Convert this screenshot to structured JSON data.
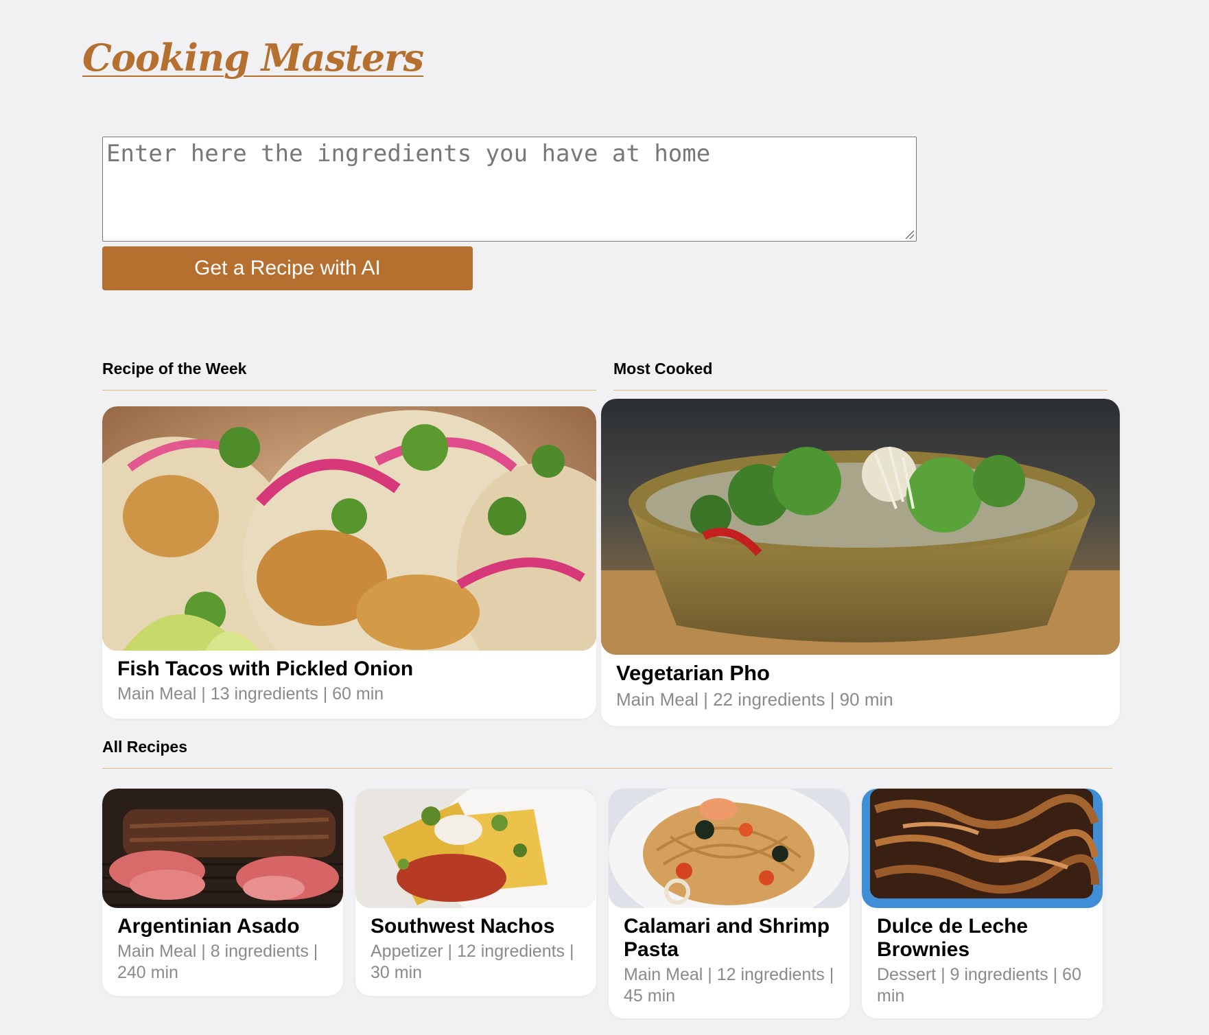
{
  "header": {
    "logo_text": "Cooking Masters"
  },
  "search": {
    "placeholder": "Enter here the ingredients you have at home",
    "value": "",
    "button_label": "Get a Recipe with AI"
  },
  "colors": {
    "brand": "#b56f2f",
    "rule": "#e2b872",
    "background": "#f1f1f3",
    "meta_text": "#8a8a8a"
  },
  "featured": {
    "recipe_of_week": {
      "heading": "Recipe of the Week",
      "title": "Fish Tacos with Pickled Onion",
      "meta": "Main Meal | 13 ingredients | 60 min",
      "image": "fish-tacos-photo"
    },
    "most_cooked": {
      "heading": "Most Cooked",
      "title": "Vegetarian Pho",
      "meta": "Main Meal | 22 ingredients | 90 min",
      "image": "vegetarian-pho-photo"
    }
  },
  "all_recipes": {
    "heading": "All Recipes",
    "items": [
      {
        "title": "Argentinian Asado",
        "meta": "Main Meal | 8 ingredients | 240 min",
        "image": "asado-photo"
      },
      {
        "title": "Southwest Nachos",
        "meta": "Appetizer | 12 ingredients | 30 min",
        "image": "nachos-photo"
      },
      {
        "title": "Calamari and Shrimp Pasta",
        "meta": "Main Meal | 12 ingredients | 45 min",
        "image": "seafood-pasta-photo"
      },
      {
        "title": "Dulce de Leche Brownies",
        "meta": "Dessert | 9 ingredients | 60 min",
        "image": "brownies-photo"
      }
    ]
  }
}
